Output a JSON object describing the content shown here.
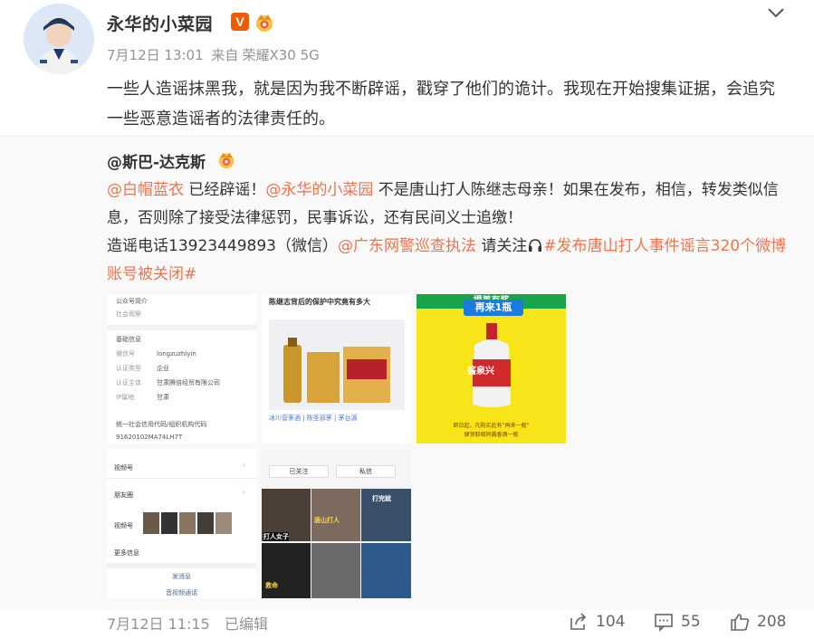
{
  "post": {
    "username": "永华的小菜园",
    "verified_badge": "V",
    "timestamp": "7月12日 13:01",
    "source_prefix": "来自",
    "device": "荣耀X30 5G",
    "text": "一些人造谣抹黑我，就是因为我不断辟谣，戳穿了他们的诡计。我现在开始搜集证据，会追究一些恶意造谣者的法律责任的。"
  },
  "repost": {
    "author": "@斯巴-达克斯",
    "segments": {
      "s1": "@白帽蓝衣",
      "s2": " 已经辟谣！",
      "s3": "@永华的小菜园",
      "s4": " 不是唐山打人陈继志母亲！如果在发布，相信，转发类似信息，否则除了接受法律惩罚，民事诉讼，还有民间义士追缴！",
      "s5": "造谣电话13923449893（微信）",
      "s6": "@广东网警巡查执法",
      "s7": " 请关注",
      "s8": "#发布唐山打人事件谣言320个微博账号被关闭#"
    },
    "images": {
      "img1": {
        "title": "公众号简介",
        "row1": "社会观察",
        "section": "基础信息",
        "k1": "微信号",
        "v1": "longzuzhiyin",
        "k2": "认证类型",
        "v2": "企业",
        "k3": "认证主体",
        "v3": "甘肃腾倍经贸有限公司",
        "k4": "IP属地",
        "v4": "甘肃",
        "k5": "统一社会信用代码/组织机构代码",
        "v5": "91620102MA74LH7T"
      },
      "img2": {
        "title": "陈继志背后的保护中究竟有多大",
        "caption": "冰川营茅酒 | 陈圣邪茅 | 茅台源"
      },
      "img3": {
        "top": "揭盖有奖",
        "badge": "再来1瓶",
        "bottle": "酱泉兴",
        "note1": "即日起，凡购买此有“再来一瓶”",
        "note2": "便领取相同酱香酒一瓶"
      },
      "img4": {
        "r1": "视频号",
        "r2": "朋友圈",
        "r3": "视频号",
        "r4": "更多信息",
        "msg": "发消息",
        "more": "音视频通话"
      },
      "img5": {
        "top": "已关注",
        "top2": "私信",
        "t1": "打人女子",
        "t2": "唐山打人",
        "t3": "打完就",
        "t4": "救命"
      }
    }
  },
  "footer": {
    "time": "7月12日 11:15",
    "edited": "已编辑",
    "share_count": "104",
    "comment_count": "55",
    "like_count": "208"
  },
  "colors": {
    "link": "#eb7350",
    "meta": "#939393",
    "repost_bg": "#f9f9f9",
    "badge_orange": "#f05a00"
  }
}
